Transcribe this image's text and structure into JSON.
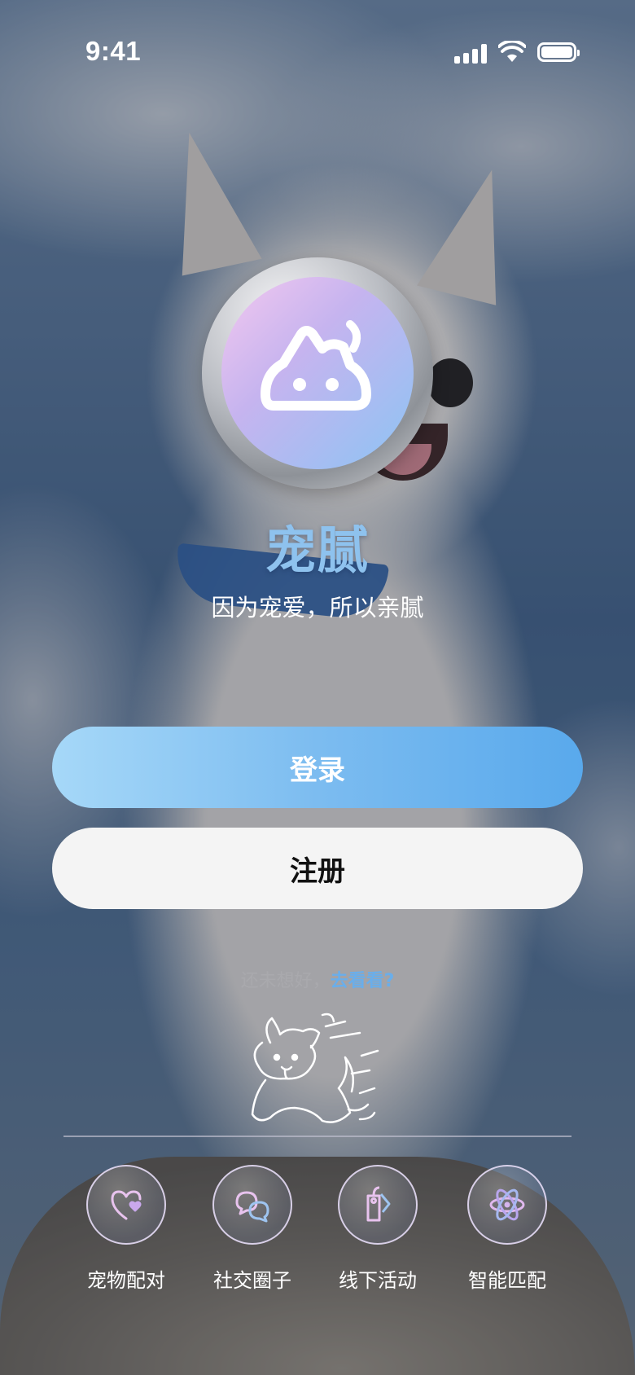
{
  "status_bar": {
    "time": "9:41"
  },
  "app": {
    "name": "宠腻",
    "tagline": "因为宠爱，所以亲腻"
  },
  "buttons": {
    "login": "登录",
    "register": "注册"
  },
  "browse_prompt": {
    "text": "还未想好，",
    "link": "去看看?"
  },
  "features": [
    {
      "label": "宠物配对",
      "icon": "heart-paw-icon"
    },
    {
      "label": "社交圈子",
      "icon": "chat-bubbles-icon"
    },
    {
      "label": "线下活动",
      "icon": "tag-icon"
    },
    {
      "label": "智能匹配",
      "icon": "atom-icon"
    }
  ],
  "colors": {
    "accent": "#6aaeea",
    "login_gradient_start": "#a6d8f8",
    "login_gradient_end": "#59a9ec",
    "register_bg": "#f4f4f4"
  }
}
